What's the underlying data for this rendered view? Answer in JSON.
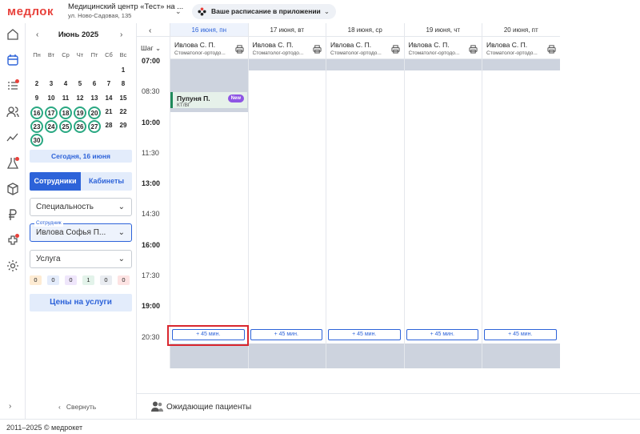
{
  "header": {
    "logo": "медлок",
    "clinic_name": "Медицинский центр «Тест» на ...",
    "clinic_address": "ул. Ново-Садовая, 135",
    "promo": "Ваше расписание в приложении"
  },
  "calendar": {
    "month": "Июнь 2025",
    "weekdays": [
      "Пн",
      "Вт",
      "Ср",
      "Чт",
      "Пт",
      "Сб",
      "Вс"
    ],
    "days": [
      "1",
      "2",
      "3",
      "4",
      "5",
      "6",
      "7",
      "8",
      "9",
      "10",
      "11",
      "12",
      "13",
      "14",
      "15",
      "16",
      "17",
      "18",
      "19",
      "20",
      "21",
      "22",
      "23",
      "24",
      "25",
      "26",
      "27",
      "28",
      "29",
      "30"
    ],
    "ringed_days": [
      "16",
      "17",
      "18",
      "19",
      "20",
      "23",
      "24",
      "25",
      "26",
      "27",
      "30"
    ],
    "today_button": "Сегодня, 16 июня"
  },
  "tabs": {
    "staff": "Сотрудники",
    "rooms": "Кабинеты"
  },
  "filters": {
    "specialty": "Специальность",
    "employee_label": "Сотрудник",
    "employee_value": "Ивлова Софья П...",
    "service": "Услуга"
  },
  "counters": [
    "0",
    "0",
    "0",
    "1",
    "0",
    "0"
  ],
  "counter_colors": [
    "#fdebd3",
    "#e4ecfb",
    "#efe6fb",
    "#e3f3ea",
    "#e9ecf1",
    "#fde3e3"
  ],
  "prices_button": "Цены на услуги",
  "collapse_label": "Свернуть",
  "schedule": {
    "step_label": "Шаг",
    "days": [
      {
        "label": "16 июня, пн",
        "doctor": "Ивлова С. П.",
        "spec": "Стоматолог-ортодо..."
      },
      {
        "label": "17 июня, вт",
        "doctor": "Ивлова С. П.",
        "spec": "Стоматолог-ортодо..."
      },
      {
        "label": "18 июня, ср",
        "doctor": "Ивлова С. П.",
        "spec": "Стоматолог-ортодо..."
      },
      {
        "label": "19 июня, чт",
        "doctor": "Ивлова С. П.",
        "spec": "Стоматолог-ортодо..."
      },
      {
        "label": "20 июня, пт",
        "doctor": "Ивлова С. П.",
        "spec": "Стоматолог-ортодо..."
      }
    ],
    "times": [
      "07:00",
      "08:30",
      "10:00",
      "11:30",
      "13:00",
      "14:30",
      "16:00",
      "17:30",
      "19:00",
      "20:30"
    ],
    "bold_times": [
      "07:00",
      "10:00",
      "13:00",
      "16:00",
      "19:00"
    ],
    "appointment": {
      "patient": "Пупуня П.",
      "sub": "КТ/ВГ",
      "badge": "New"
    },
    "add_slot": "+ 45 мин."
  },
  "waiting_patients": "Ожидающие пациенты",
  "footer": "2011–2025 © медрокет",
  "colors": {
    "accent": "#2d63d9",
    "brand": "#e8413b",
    "ring": "#2aa882",
    "closed": "#cdd3de"
  }
}
